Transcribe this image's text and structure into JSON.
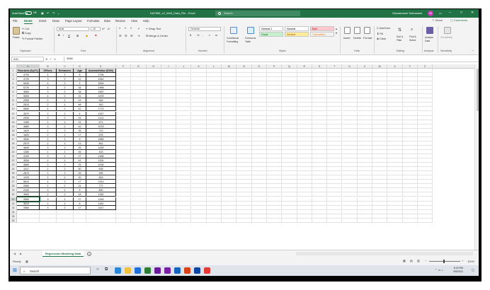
{
  "titlebar": {
    "autosave_label": "AutoSave",
    "autosave_state": "Off",
    "filename": "DAT565_v2_Wk5_Data_File - Excel",
    "search_placeholder": "Search",
    "user_name": "Oluwabunmi Sotesanmi",
    "user_initials": "OS"
  },
  "ribbon_tabs": [
    "File",
    "Home",
    "Insert",
    "Draw",
    "Page Layout",
    "Formulas",
    "Data",
    "Review",
    "View",
    "Help"
  ],
  "ribbon_actions": {
    "share": "Share",
    "comments": "Comments"
  },
  "clipboard": {
    "paste": "Paste",
    "cut": "Cut",
    "copy": "Copy",
    "format_painter": "Format Painter",
    "group": "Clipboard"
  },
  "font": {
    "name": "Arial",
    "size": "10",
    "group": "Font"
  },
  "alignment": {
    "wrap": "Wrap Text",
    "merge": "Merge & Center",
    "group": "Alignment"
  },
  "number": {
    "format": "General",
    "group": "Number"
  },
  "styles": {
    "conditional": "Conditional Formatting",
    "format_table": "Format as Table",
    "cells": [
      {
        "label": "Normal 2",
        "bg": "#ffffff",
        "fg": "#000000"
      },
      {
        "label": "Normal",
        "bg": "#ffffff",
        "fg": "#000000"
      },
      {
        "label": "Bad",
        "bg": "#ffc7ce",
        "fg": "#9c0006"
      },
      {
        "label": "Good",
        "bg": "#c6efce",
        "fg": "#006100"
      },
      {
        "label": "Neutral",
        "bg": "#ffeb9c",
        "fg": "#9c5700"
      },
      {
        "label": "Calculation",
        "bg": "#f2f2f2",
        "fg": "#fa7d00"
      }
    ],
    "group": "Styles"
  },
  "cells_group": {
    "insert": "Insert",
    "delete": "Delete",
    "format": "Format",
    "group": "Cells"
  },
  "editing": {
    "autosum": "AutoSum",
    "fill": "Fill",
    "clear": "Clear",
    "sort_filter": "Sort & Filter",
    "find_select": "Find & Select",
    "group": "Editing"
  },
  "analysis": {
    "analyze": "Analyze Data",
    "group": "Analysis"
  },
  "sensitivity": {
    "label": "Sensitivity",
    "group": "Sensitivity"
  },
  "formula_bar": {
    "name_box": "A31",
    "fx": "fx",
    "value": "3580"
  },
  "columns": [
    "A",
    "B",
    "C",
    "D",
    "E",
    "F",
    "G",
    "H",
    "I",
    "J",
    "K",
    "L",
    "M",
    "N",
    "O",
    "P",
    "Q",
    "R",
    "S",
    "T",
    "U",
    "V",
    "W",
    "X",
    "Y",
    "Z"
  ],
  "table": {
    "headers": [
      "FloorArea (Sq.Ft.)",
      "Offices",
      "Entrances",
      "Age",
      "AssessedValue ($'000)"
    ],
    "rows": [
      [
        "4790",
        "4",
        "2",
        "8",
        "1796"
      ],
      [
        "4720",
        "3",
        "2",
        "12",
        "1544"
      ],
      [
        "5940",
        "4",
        "2",
        "2",
        "2094"
      ],
      [
        "5720",
        "4",
        "2",
        "34",
        "1968"
      ],
      [
        "3660",
        "3",
        "2",
        "38",
        "1567"
      ],
      [
        "5000",
        "4",
        "2",
        "31",
        "1878"
      ],
      [
        "2990",
        "2",
        "1",
        "19",
        "949"
      ],
      [
        "2610",
        "2",
        "1",
        "48",
        "910"
      ],
      [
        "5650",
        "4",
        "2",
        "42",
        "1774"
      ],
      [
        "3570",
        "2",
        "1",
        "4",
        "1187"
      ],
      [
        "2930",
        "3",
        "2",
        "15",
        "1113"
      ],
      [
        "1280",
        "2",
        "1",
        "31",
        "671"
      ],
      [
        "4880",
        "3",
        "2",
        "42",
        "1678"
      ],
      [
        "1620",
        "1",
        "2",
        "35",
        "710"
      ],
      [
        "1820",
        "2",
        "1",
        "17",
        "678"
      ],
      [
        "4530",
        "2",
        "2",
        "5",
        "1585"
      ],
      [
        "2570",
        "2",
        "1",
        "13",
        "842"
      ],
      [
        "4690",
        "2",
        "2",
        "45",
        "1539"
      ],
      [
        "1280",
        "1",
        "1",
        "45",
        "433"
      ],
      [
        "4100",
        "3",
        "1",
        "27",
        "1268"
      ],
      [
        "3530",
        "2",
        "2",
        "41",
        "1251"
      ],
      [
        "3660",
        "2",
        "2",
        "33",
        "1094"
      ],
      [
        "1110",
        "1",
        "2",
        "50",
        "638"
      ],
      [
        "2670",
        "2",
        "2",
        "39",
        "999"
      ],
      [
        "1100",
        "1",
        "2",
        "20",
        "653"
      ],
      [
        "5810",
        "4",
        "3",
        "17",
        "1914"
      ],
      [
        "2560",
        "2",
        "2",
        "24",
        "772"
      ],
      [
        "2340",
        "3",
        "1",
        "5",
        "890"
      ],
      [
        "3690",
        "2",
        "2",
        "15",
        "1282"
      ],
      [
        "3580",
        "3",
        "2",
        "27",
        "1264"
      ],
      [
        "3610",
        "2",
        "1",
        "8",
        "1162"
      ],
      [
        "3960",
        "3",
        "2",
        "17",
        "1447"
      ]
    ]
  },
  "extra_rows": [
    "34",
    "35",
    "36"
  ],
  "sheet_tab": "Regression Modeling Data",
  "status": {
    "ready": "Ready",
    "zoom": "100%"
  },
  "taskbar": {
    "search_placeholder": "Search",
    "time": "5:23 PM",
    "date": "3/9/2021"
  }
}
